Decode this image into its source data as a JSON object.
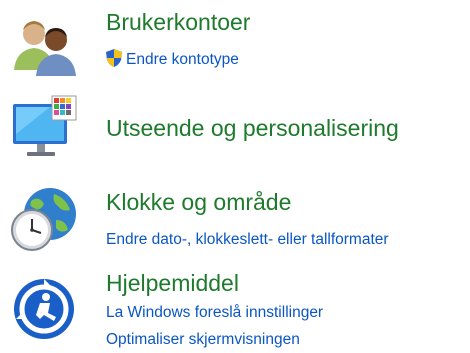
{
  "categories": [
    {
      "icon": "user-accounts-icon",
      "title": "Brukerkontoer",
      "links": [
        {
          "label": "Endre kontotype",
          "icon": "uac-shield-icon"
        }
      ]
    },
    {
      "icon": "appearance-personalization-icon",
      "title": "Utseende og personalisering",
      "links": []
    },
    {
      "icon": "clock-region-icon",
      "title": "Klokke og område",
      "links": [
        {
          "label": "Endre dato-, klokkeslett- eller tallformater"
        }
      ]
    },
    {
      "icon": "ease-of-access-icon",
      "title": "Hjelpemiddel",
      "links": [
        {
          "label": "La Windows foreslå innstillinger"
        },
        {
          "label": "Optimaliser skjermvisningen"
        }
      ]
    }
  ],
  "colors": {
    "title": "#1e7a2c",
    "link": "#0a56c4",
    "background": "#ffffff"
  }
}
